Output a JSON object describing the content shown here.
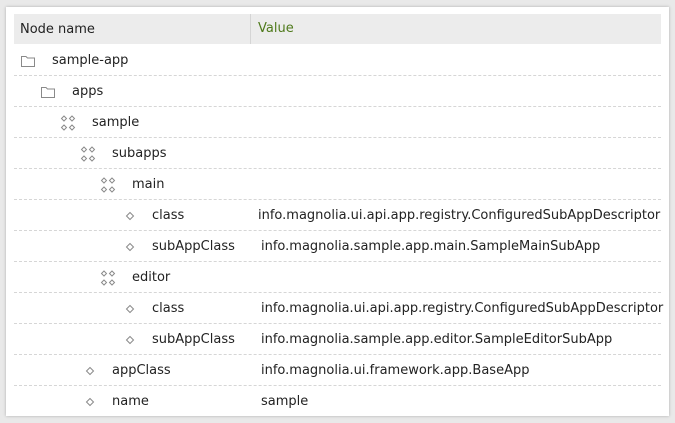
{
  "table": {
    "headers": {
      "name": "Node name",
      "value": "Value"
    },
    "rows": [
      {
        "name": "sample-app",
        "value": "",
        "icon": "folder-icon"
      },
      {
        "name": "apps",
        "value": "",
        "icon": "folder-icon"
      },
      {
        "name": "sample",
        "value": "",
        "icon": "content-node-icon"
      },
      {
        "name": "subapps",
        "value": "",
        "icon": "content-node-icon"
      },
      {
        "name": "main",
        "value": "",
        "icon": "content-node-icon"
      },
      {
        "name": "class",
        "value": "info.magnolia.ui.api.app.registry.ConfiguredSubAppDescriptor",
        "icon": "property-icon"
      },
      {
        "name": "subAppClass",
        "value": "info.magnolia.sample.app.main.SampleMainSubApp",
        "icon": "property-icon"
      },
      {
        "name": "editor",
        "value": "",
        "icon": "content-node-icon"
      },
      {
        "name": "class",
        "value": "info.magnolia.ui.api.app.registry.ConfiguredSubAppDescriptor",
        "icon": "property-icon"
      },
      {
        "name": "subAppClass",
        "value": "info.magnolia.sample.app.editor.SampleEditorSubApp",
        "icon": "property-icon"
      },
      {
        "name": "appClass",
        "value": "info.magnolia.ui.framework.app.BaseApp",
        "icon": "property-icon"
      },
      {
        "name": "name",
        "value": "sample",
        "icon": "property-icon"
      }
    ]
  },
  "colors": {
    "value_header": "#4f7a1c",
    "row_divider": "#d6d6d6",
    "header_bg": "#ececec"
  }
}
